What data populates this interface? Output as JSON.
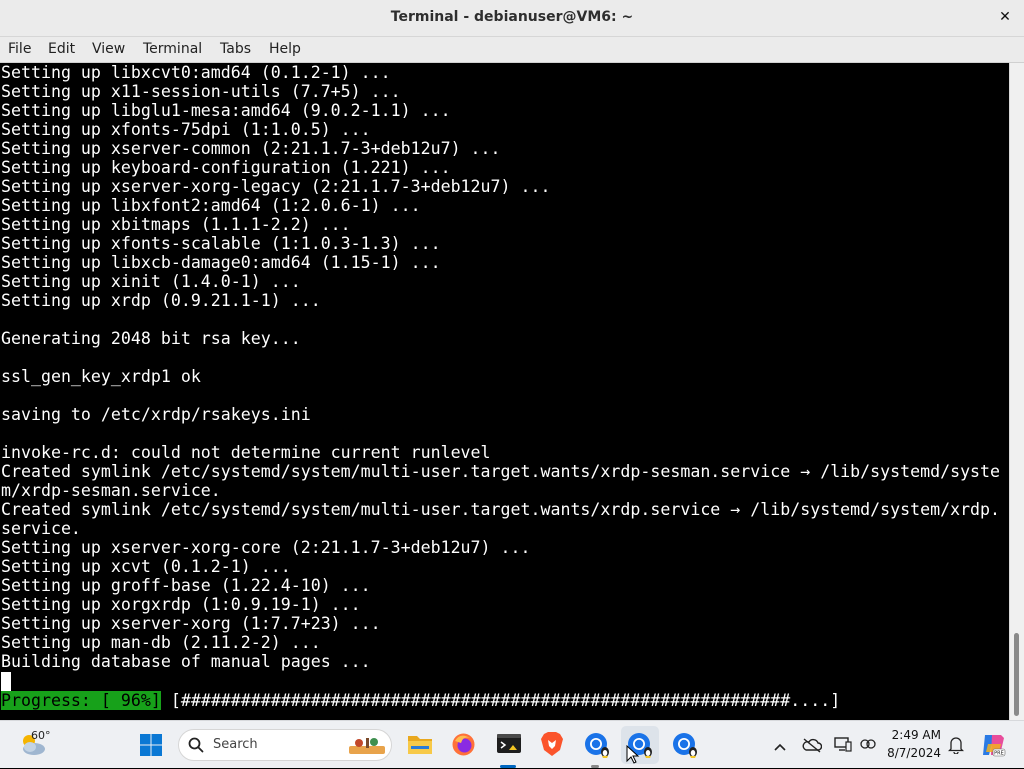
{
  "window": {
    "title": "Terminal - debianuser@VM6: ~",
    "close_glyph": "✕"
  },
  "menu": [
    "File",
    "Edit",
    "View",
    "Terminal",
    "Tabs",
    "Help"
  ],
  "terminal": {
    "lines": [
      "Setting up libxcvt0:amd64 (0.1.2-1) ...",
      "Setting up x11-session-utils (7.7+5) ...",
      "Setting up libglu1-mesa:amd64 (9.0.2-1.1) ...",
      "Setting up xfonts-75dpi (1:1.0.5) ...",
      "Setting up xserver-common (2:21.1.7-3+deb12u7) ...",
      "Setting up keyboard-configuration (1.221) ...",
      "Setting up xserver-xorg-legacy (2:21.1.7-3+deb12u7) ...",
      "Setting up libxfont2:amd64 (1:2.0.6-1) ...",
      "Setting up xbitmaps (1.1.1-2.2) ...",
      "Setting up xfonts-scalable (1:1.0.3-1.3) ...",
      "Setting up libxcb-damage0:amd64 (1.15-1) ...",
      "Setting up xinit (1.4.0-1) ...",
      "Setting up xrdp (0.9.21.1-1) ...",
      "",
      "Generating 2048 bit rsa key...",
      "",
      "ssl_gen_key_xrdp1 ok",
      "",
      "saving to /etc/xrdp/rsakeys.ini",
      "",
      "invoke-rc.d: could not determine current runlevel",
      "Created symlink /etc/systemd/system/multi-user.target.wants/xrdp-sesman.service → /lib/systemd/syste",
      "m/xrdp-sesman.service.",
      "Created symlink /etc/systemd/system/multi-user.target.wants/xrdp.service → /lib/systemd/system/xrdp.",
      "service.",
      "Setting up xserver-xorg-core (2:21.1.7-3+deb12u7) ...",
      "Setting up xcvt (0.1.2-1) ...",
      "Setting up groff-base (1.22.4-10) ...",
      "Setting up xorgxrdp (1:0.9.19-1) ...",
      "Setting up xserver-xorg (1:7.7+23) ...",
      "Setting up man-db (2.11.2-2) ...",
      "Building database of manual pages ..."
    ],
    "progress_label": "Progress: [ 96%]",
    "progress_bar": "[#############################################################....]",
    "progress_percent": 96
  },
  "taskbar": {
    "weather_temp": "60°",
    "search_placeholder": "Search",
    "time": "2:49 AM",
    "date": "8/7/2024",
    "icons": [
      "weather-icon",
      "start-icon",
      "search-icon",
      "file-explorer-icon",
      "firefox-icon",
      "terminal-app-icon",
      "brave-icon",
      "chrome-linux-icon",
      "chrome-linux-icon",
      "chrome-linux-icon",
      "chevron-up-icon",
      "onedrive-icon",
      "display-icon",
      "network-icon",
      "notification-bell-icon",
      "copilot-icon"
    ],
    "colors": {
      "accent": "#0067c0",
      "progress": "#17a11a"
    }
  }
}
